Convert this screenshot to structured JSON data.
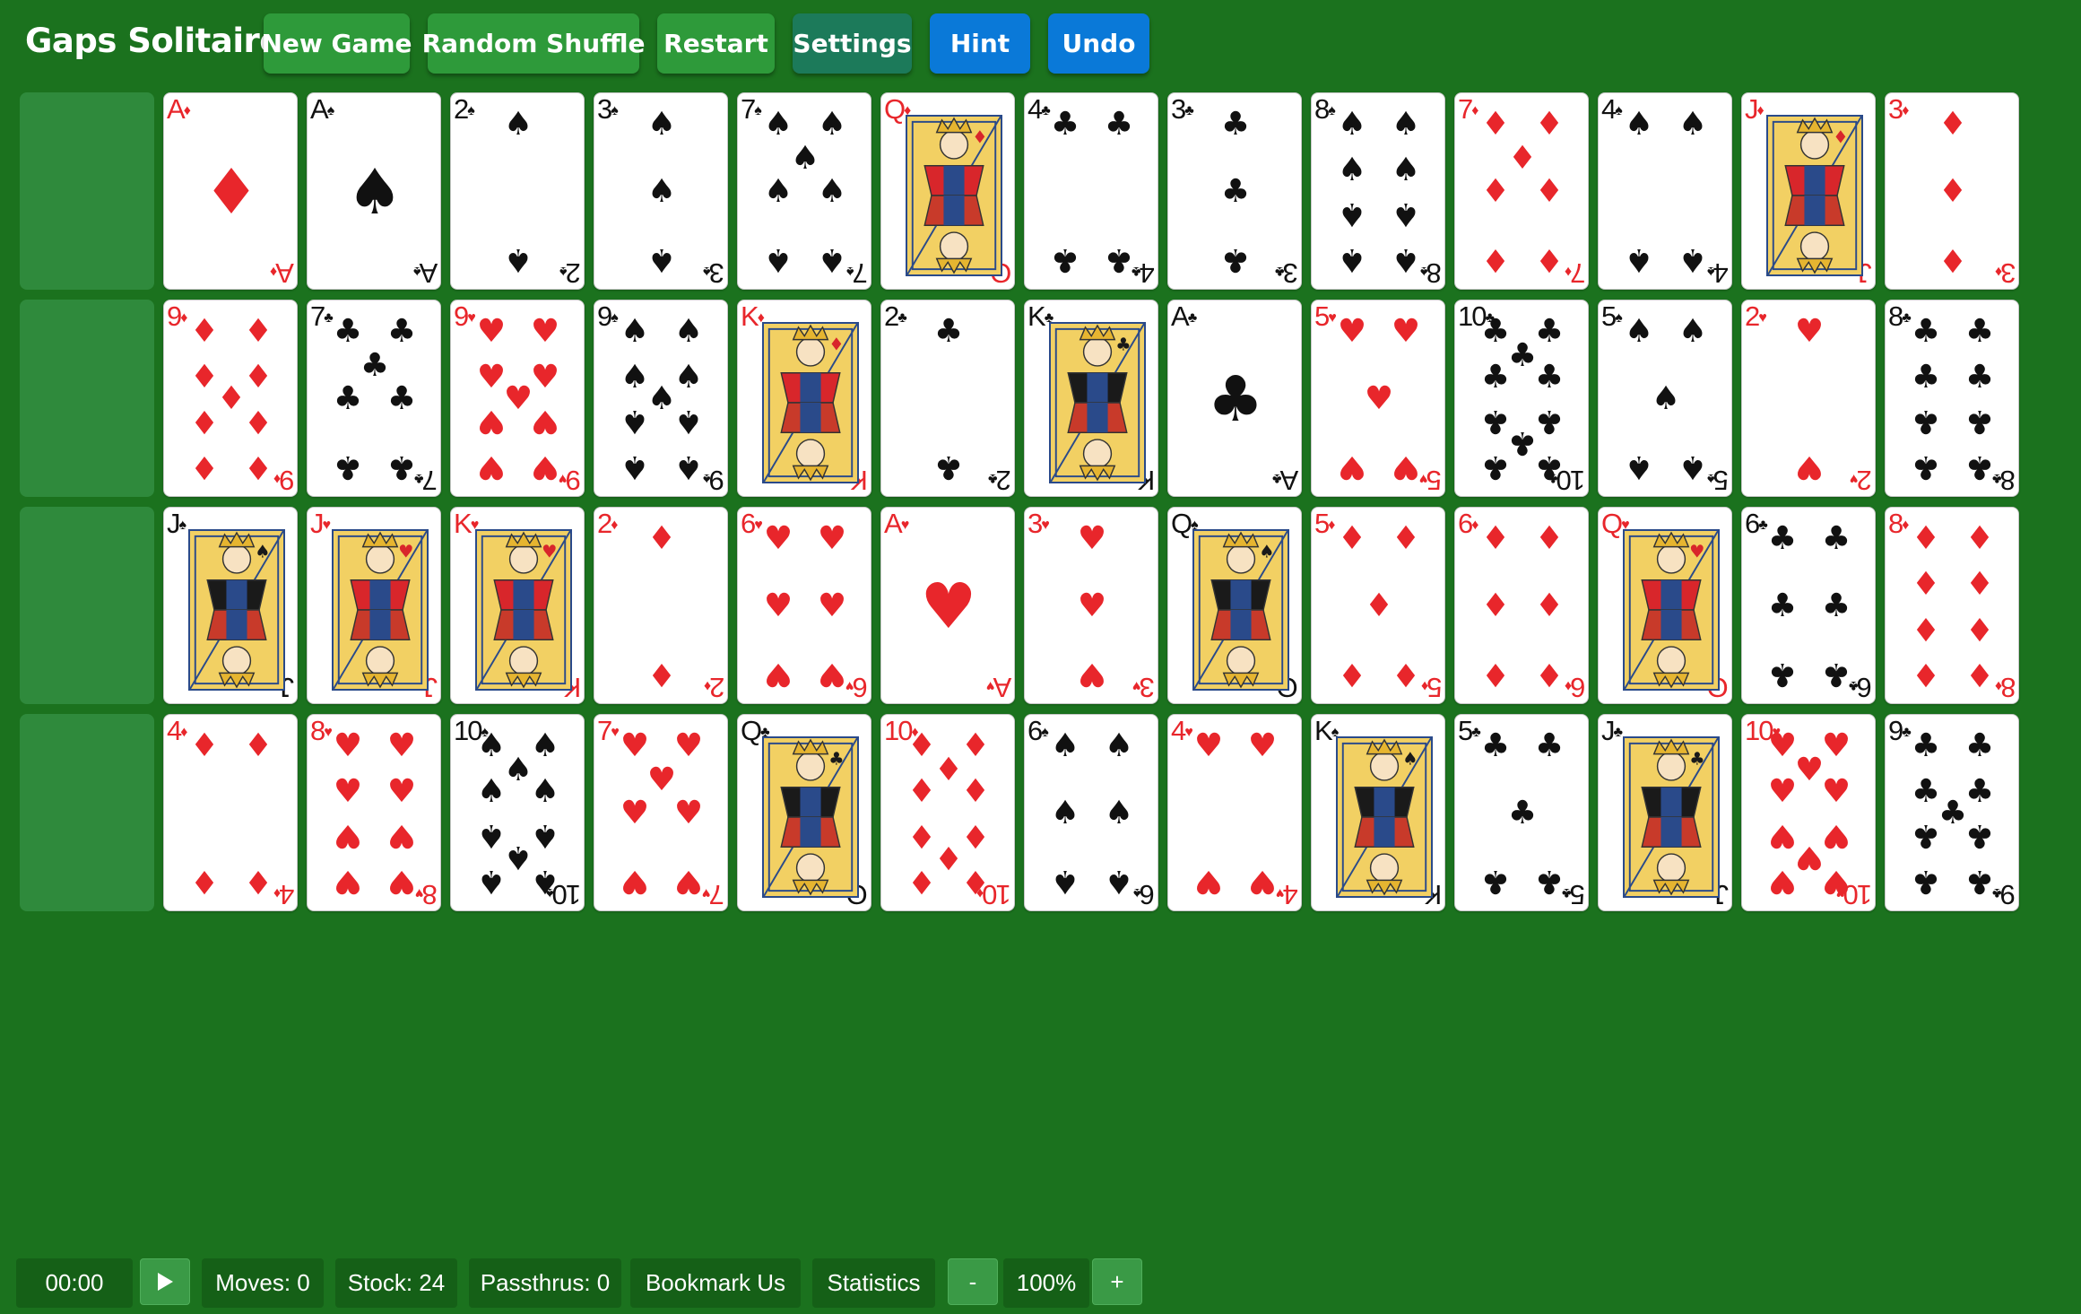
{
  "header": {
    "title": "Gaps Solitaire",
    "buttons": {
      "new_game": "New Game",
      "random_shuffle": "Random Shuffle",
      "restart": "Restart",
      "settings": "Settings",
      "hint": "Hint",
      "undo": "Undo"
    }
  },
  "board": {
    "rows": [
      [
        "",
        "A♦",
        "A♠",
        "2♠",
        "3♠",
        "7♠",
        "Q♦",
        "4♣",
        "3♣",
        "8♠",
        "7♦",
        "4♠",
        "J♦",
        "3♦"
      ],
      [
        "",
        "9♦",
        "7♣",
        "9♥",
        "9♠",
        "K♦",
        "2♣",
        "K♣",
        "A♣",
        "5♥",
        "10♣",
        "5♠",
        "2♥",
        "8♣"
      ],
      [
        "",
        "J♠",
        "J♥",
        "K♥",
        "2♦",
        "6♥",
        "A♥",
        "3♥",
        "Q♠",
        "5♦",
        "6♦",
        "Q♥",
        "6♣",
        "8♦"
      ],
      [
        "",
        "4♦",
        "8♥",
        "10♠",
        "7♥",
        "Q♣",
        "10♦",
        "6♠",
        "4♥",
        "K♠",
        "5♣",
        "J♣",
        "10♥",
        "9♣"
      ]
    ]
  },
  "colors": {
    "background": "#1b721e",
    "gap": "#2f8a3c",
    "red_suit": "#e8262b",
    "black_suit": "#111111",
    "button_green": "#2e9a3a",
    "button_blue": "#0a79d8"
  },
  "footer": {
    "timer": "00:00",
    "play_icon": "play-icon",
    "moves": "Moves: 0",
    "stock": "Stock: 24",
    "passthrus": "Passthrus: 0",
    "bookmark": "Bookmark Us",
    "statistics": "Statistics",
    "zoom_out": "-",
    "zoom": "100%",
    "zoom_in": "+"
  }
}
